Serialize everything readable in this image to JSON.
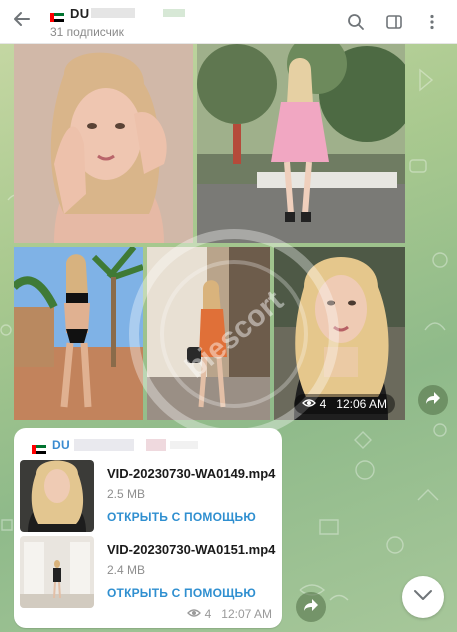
{
  "header": {
    "channel_name": "DU",
    "subscribers": "31 подписчик",
    "icons": [
      "back-arrow-icon",
      "search-icon",
      "sidebar-toggle-icon",
      "more-vertical-icon"
    ]
  },
  "album": {
    "views": "4",
    "time": "12:06 AM",
    "watermark_text": "biescort"
  },
  "file_message": {
    "channel_name": "DU",
    "files": [
      {
        "name": "VID-20230730-WA0149.mp4",
        "size": "2.5 MB",
        "action": "ОТКРЫТЬ С ПОМОЩЬЮ"
      },
      {
        "name": "VID-20230730-WA0151.mp4",
        "size": "2.4 MB",
        "action": "ОТКРЫТЬ С ПОМОЩЬЮ"
      }
    ],
    "views": "4",
    "time": "12:07 AM"
  },
  "colors": {
    "accent": "#2f8fd0",
    "background": "#a9c98f",
    "bubble": "#ffffff"
  }
}
